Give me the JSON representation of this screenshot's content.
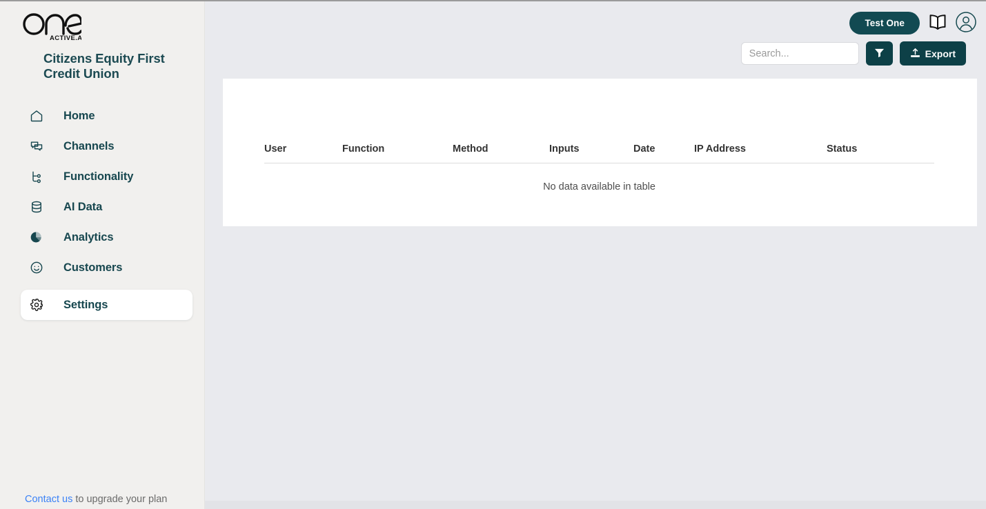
{
  "brand": {
    "logo_text": "one",
    "logo_subtext": "ACTIVE.Ai",
    "logo_icon": "one-activeai-logo",
    "org_name": "Citizens Equity First Credit Union"
  },
  "sidebar": {
    "items": [
      {
        "label": "Home",
        "icon": "home-icon",
        "active": false
      },
      {
        "label": "Channels",
        "icon": "chat-bubbles-icon",
        "active": false
      },
      {
        "label": "Functionality",
        "icon": "git-branch-icon",
        "active": false
      },
      {
        "label": "AI Data",
        "icon": "database-icon",
        "active": false
      },
      {
        "label": "Analytics",
        "icon": "pie-chart-icon",
        "active": false
      },
      {
        "label": "Customers",
        "icon": "smiley-icon",
        "active": false
      },
      {
        "label": "Settings",
        "icon": "gear-icon",
        "active": true
      }
    ],
    "footer": {
      "link_text": "Contact us",
      "rest_text": " to upgrade your plan"
    }
  },
  "header": {
    "user_button_label": "Test One",
    "book_icon": "book-icon",
    "avatar_icon": "user-avatar-icon"
  },
  "toolbar": {
    "search_placeholder": "Search...",
    "search_value": "",
    "filter_icon": "funnel-filter-icon",
    "export_label": "Export",
    "export_icon": "upload-export-icon"
  },
  "table": {
    "columns": [
      "User",
      "Function",
      "Method",
      "Inputs",
      "Date",
      "IP Address",
      "Status"
    ],
    "rows": [],
    "empty_message": "No data available in table"
  },
  "colors": {
    "accent_dark_teal": "#0d4047",
    "pill_teal": "#124a52",
    "sidebar_bg": "#f1f0ee",
    "main_bg": "#e9eaee",
    "link_blue": "#3b82f6",
    "nav_text": "#17474f"
  }
}
